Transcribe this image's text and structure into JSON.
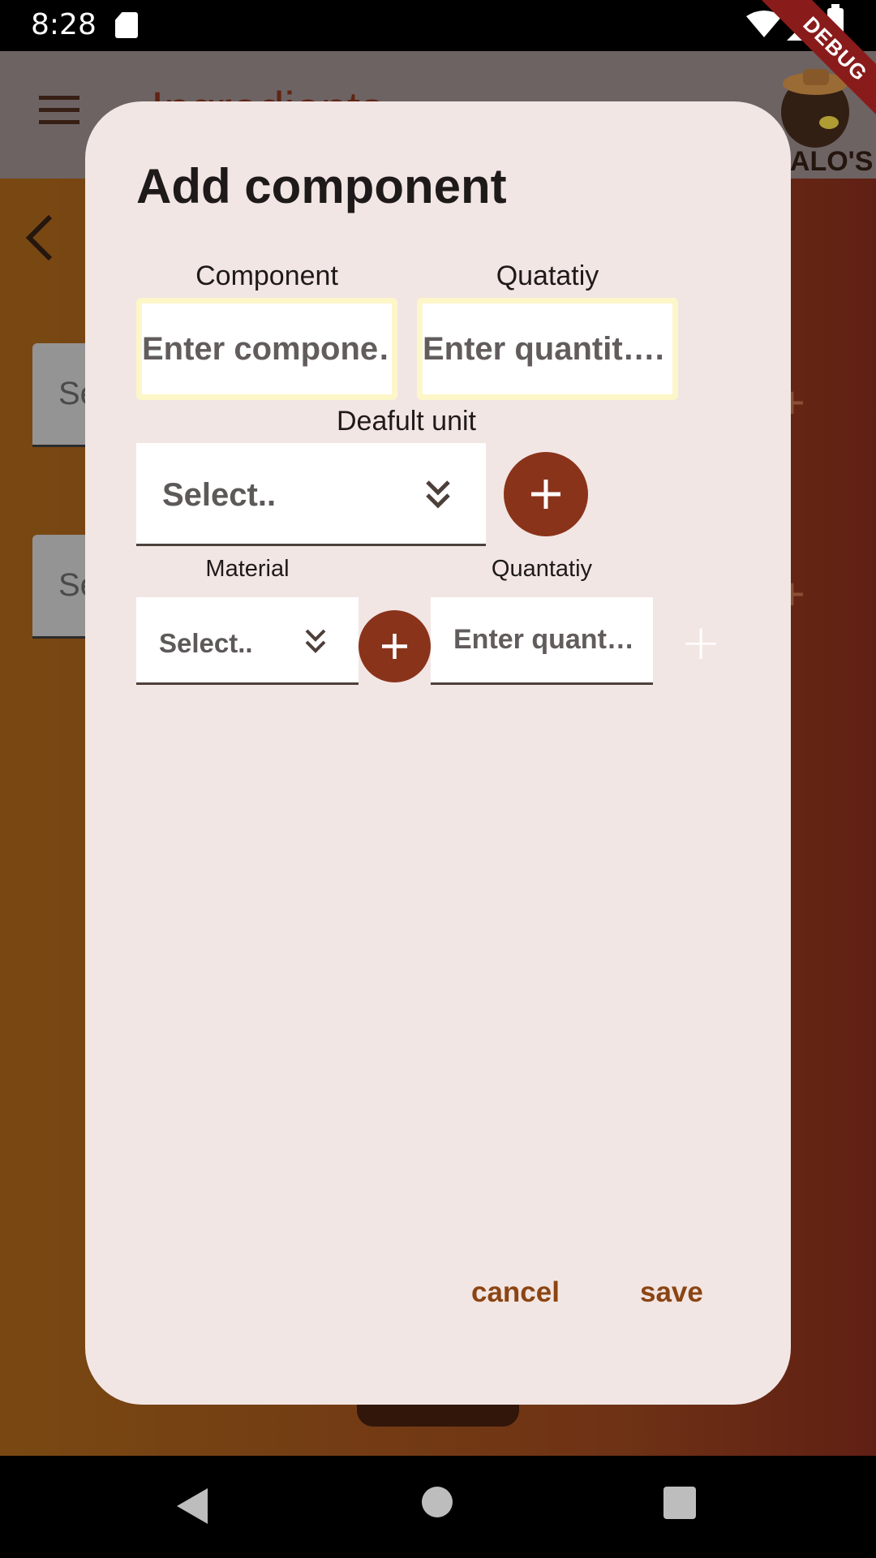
{
  "status_bar": {
    "time": "8:28"
  },
  "background_app": {
    "title": "Ingredients",
    "logo_text": "FALO'S",
    "card_label": "Se",
    "plus": "+"
  },
  "debug_banner": "DEBUG",
  "dialog": {
    "title": "Add component",
    "component": {
      "label": "Component",
      "placeholder": "Enter compone…"
    },
    "quantity": {
      "label": "Quatatiy",
      "placeholder": "Enter quantit…."
    },
    "default_unit": {
      "label": "Deafult unit",
      "value": "Select.."
    },
    "material": {
      "label": "Material",
      "value": "Select.."
    },
    "material_quantity": {
      "label": "Quantatiy",
      "placeholder": "Enter quant…"
    },
    "plus_symbol": "+",
    "cancel_label": "cancel",
    "save_label": "save"
  },
  "colors": {
    "accent": "#8a331b",
    "action_text": "#8b4513",
    "dialog_bg": "#f2e6e4",
    "input_border": "#fdf6c8"
  }
}
